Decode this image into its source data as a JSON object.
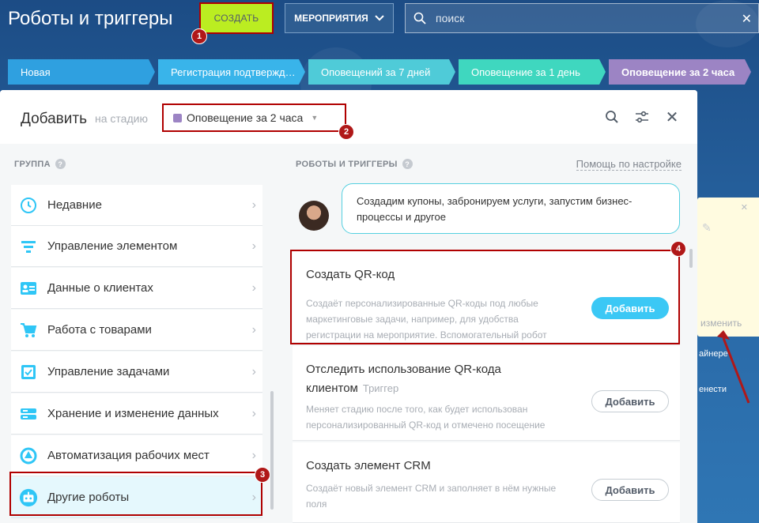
{
  "header": {
    "title": "Роботы и триггеры",
    "create_label": "СОЗДАТЬ",
    "events_label": "МЕРОПРИЯТИЯ",
    "search_placeholder": "поиск"
  },
  "stages": [
    {
      "label": "Новая",
      "color": "#2fa0e0"
    },
    {
      "label": "Регистрация подтвержд…",
      "color": "#39b4ea"
    },
    {
      "label": "Оповещений за 7 дней",
      "color": "#4fcbd8"
    },
    {
      "label": "Оповещение за 1 день",
      "color": "#3fd7bf"
    },
    {
      "label": "Оповещение за 2 часа",
      "color": "#9c84c4"
    }
  ],
  "panel": {
    "add_label": "Добавить",
    "on_stage_label": "на стадию",
    "selected_stage": "Оповещение за 2 часа",
    "group_heading": "ГРУППА",
    "robots_heading": "РОБОТЫ И ТРИГГЕРЫ",
    "help_link": "Помощь по настройке"
  },
  "groups": [
    {
      "label": "Недавние",
      "icon": "history-icon"
    },
    {
      "label": "Управление элементом",
      "icon": "filter-icon"
    },
    {
      "label": "Данные о клиентах",
      "icon": "contact-card-icon"
    },
    {
      "label": "Работа с товарами",
      "icon": "cart-icon"
    },
    {
      "label": "Управление задачами",
      "icon": "task-icon"
    },
    {
      "label": "Хранение и изменение данных",
      "icon": "storage-icon"
    },
    {
      "label": "Автоматизация рабочих мест",
      "icon": "automation-icon"
    },
    {
      "label": "Другие роботы",
      "icon": "robot-icon"
    }
  ],
  "assistant_message": "Создадим купоны, забронируем услуги, запустим бизнес-процессы и другое",
  "robots": [
    {
      "title": "Создать QR-код",
      "type": "",
      "description": "Создаёт персонализированные QR-коды под любые маркетинговые задачи, например, для удобства регистрации на мероприятие. Вспомогательный робот",
      "button": "Добавить"
    },
    {
      "title": "Отследить использование QR-кода клиентом",
      "type": "Триггер",
      "description": "Меняет стадию после того, как будет использован персонализированный QR-код и отмечено посещение",
      "button": "Добавить"
    },
    {
      "title": "Создать элемент CRM",
      "type": "",
      "description": "Создаёт новый элемент CRM и заполняет в нём нужные поля",
      "button": "Добавить"
    }
  ],
  "side": {
    "edit_label": "изменить",
    "text1": "айнере",
    "text2": "енести"
  },
  "markers": [
    "1",
    "2",
    "3",
    "4"
  ],
  "colors": {
    "accent_green": "#bbed21",
    "primary_blue": "#3bc8f5",
    "annotation_red": "#b00000"
  }
}
